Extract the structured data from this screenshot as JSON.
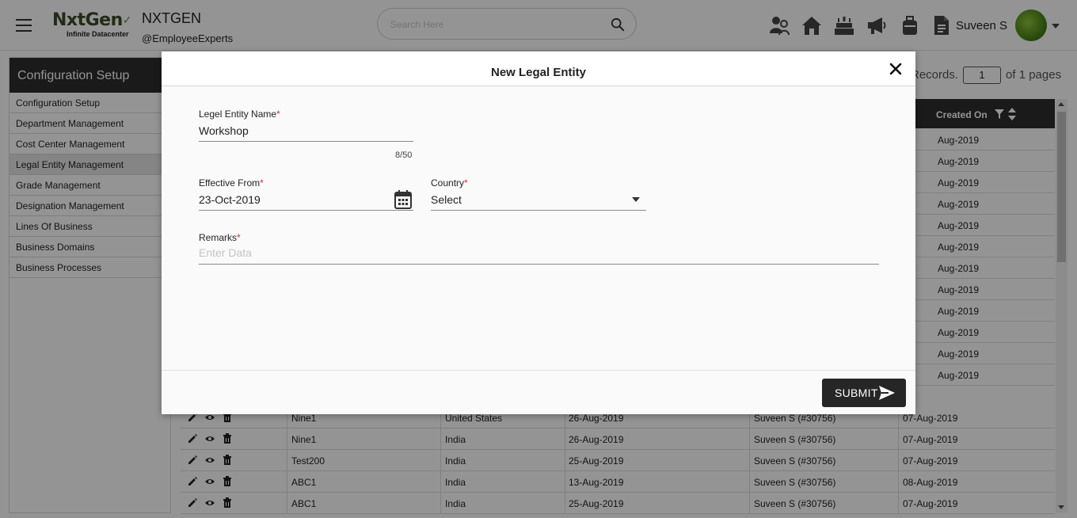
{
  "header": {
    "logo_brand": "NxtGen",
    "logo_tagline": "Infinite Datacenter",
    "company_name": "NXTGEN",
    "company_handle": "@EmployeeExperts",
    "search_placeholder": "Search Here",
    "icons": [
      "team-icon",
      "home-icon",
      "birthday-cake-icon",
      "megaphone-icon",
      "briefcase-icon",
      "document-icon"
    ],
    "username": "Suveen S"
  },
  "sidebar": {
    "title": "Configuration Setup",
    "items": [
      {
        "label": "Configuration Setup"
      },
      {
        "label": "Department Management"
      },
      {
        "label": "Cost Center Management"
      },
      {
        "label": "Legal Entity Management"
      },
      {
        "label": "Grade Management"
      },
      {
        "label": "Designation Management"
      },
      {
        "label": "Lines Of Business"
      },
      {
        "label": "Business Domains"
      },
      {
        "label": "Business Processes"
      }
    ]
  },
  "pagination": {
    "records_text": "Records.",
    "page_value": "1",
    "of_pages_text": "of 1 pages"
  },
  "table": {
    "created_on_header": "Created On",
    "partial_dates": [
      "Aug-2019",
      "Aug-2019",
      "Aug-2019",
      "Aug-2019",
      "Aug-2019",
      "Aug-2019",
      "Aug-2019",
      "Aug-2019",
      "Aug-2019",
      "Aug-2019",
      "Aug-2019",
      "Aug-2019"
    ],
    "rows": [
      {
        "name": "Nine1",
        "country": "United States",
        "effective": "26-Aug-2019",
        "created_by": "Suveen S (#30756)",
        "created_on": "07-Aug-2019"
      },
      {
        "name": "Nine1",
        "country": "India",
        "effective": "26-Aug-2019",
        "created_by": "Suveen S (#30756)",
        "created_on": "07-Aug-2019"
      },
      {
        "name": "Test200",
        "country": "India",
        "effective": "25-Aug-2019",
        "created_by": "Suveen S (#30756)",
        "created_on": "07-Aug-2019"
      },
      {
        "name": "ABC1",
        "country": "India",
        "effective": "13-Aug-2019",
        "created_by": "Suveen S (#30756)",
        "created_on": "08-Aug-2019"
      },
      {
        "name": "ABC1",
        "country": "India",
        "effective": "25-Aug-2019",
        "created_by": "Suveen S (#30756)",
        "created_on": "07-Aug-2019"
      }
    ]
  },
  "modal": {
    "title": "New Legal Entity",
    "entity_name_label": "Legel Entity Name",
    "entity_name_value": "Workshop",
    "entity_name_counter": "8/50",
    "effective_from_label": "Effective From",
    "effective_from_value": "23-Oct-2019",
    "country_label": "Country",
    "country_value": "Select",
    "remarks_label": "Remarks",
    "remarks_placeholder": "Enter Data",
    "required_marker": "*",
    "submit_label": "SUBMIT"
  },
  "colors": {
    "dark": "#2d2d2d",
    "required": "#d32f2f",
    "logo_green": "#5a9a24"
  }
}
